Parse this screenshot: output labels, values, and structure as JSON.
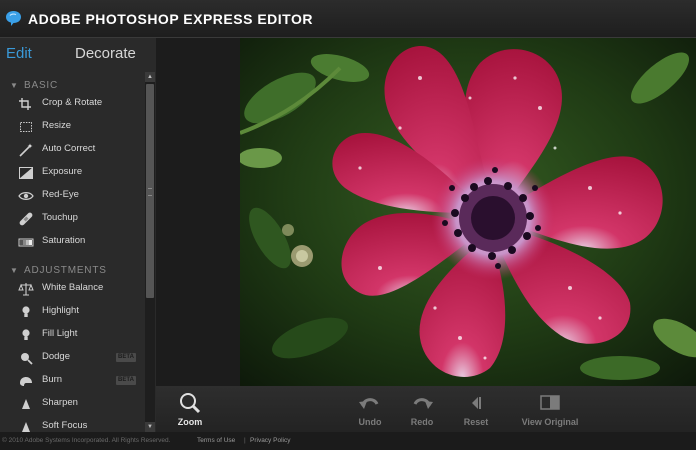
{
  "app": {
    "title": "ADOBE PHOTOSHOP EXPRESS EDITOR",
    "accent_color": "#3a9ad9"
  },
  "tabs": [
    {
      "label": "Edit",
      "active": true
    },
    {
      "label": "Decorate",
      "active": false
    }
  ],
  "sections": {
    "basic": {
      "label": "BASIC",
      "tools": [
        {
          "label": "Crop & Rotate",
          "icon": "crop-icon"
        },
        {
          "label": "Resize",
          "icon": "resize-icon"
        },
        {
          "label": "Auto Correct",
          "icon": "magic-wand-icon"
        },
        {
          "label": "Exposure",
          "icon": "exposure-icon"
        },
        {
          "label": "Red-Eye",
          "icon": "eye-icon"
        },
        {
          "label": "Touchup",
          "icon": "bandage-icon"
        },
        {
          "label": "Saturation",
          "icon": "saturation-icon"
        }
      ]
    },
    "adjustments": {
      "label": "ADJUSTMENTS",
      "tools": [
        {
          "label": "White Balance",
          "icon": "scale-icon"
        },
        {
          "label": "Highlight",
          "icon": "lightbulb-icon"
        },
        {
          "label": "Fill Light",
          "icon": "lightbulb-icon"
        },
        {
          "label": "Dodge",
          "icon": "dodge-icon",
          "badge": "BETA"
        },
        {
          "label": "Burn",
          "icon": "burn-icon",
          "badge": "BETA"
        },
        {
          "label": "Sharpen",
          "icon": "sharpen-icon"
        },
        {
          "label": "Soft Focus",
          "icon": "soft-focus-icon"
        }
      ]
    }
  },
  "bottom_toolbar": {
    "zoom": {
      "label": "Zoom",
      "icon": "magnifier-icon"
    },
    "undo": {
      "label": "Undo",
      "icon": "undo-icon"
    },
    "redo": {
      "label": "Redo",
      "icon": "redo-icon"
    },
    "reset": {
      "label": "Reset",
      "icon": "reset-icon"
    },
    "view_original": {
      "label": "View Original",
      "icon": "compare-icon"
    }
  },
  "footer": {
    "copyright": "© 2010 Adobe Systems Incorporated. All Rights Reserved.",
    "terms": "Terms of Use",
    "separator": "|",
    "privacy": "Privacy Policy"
  }
}
